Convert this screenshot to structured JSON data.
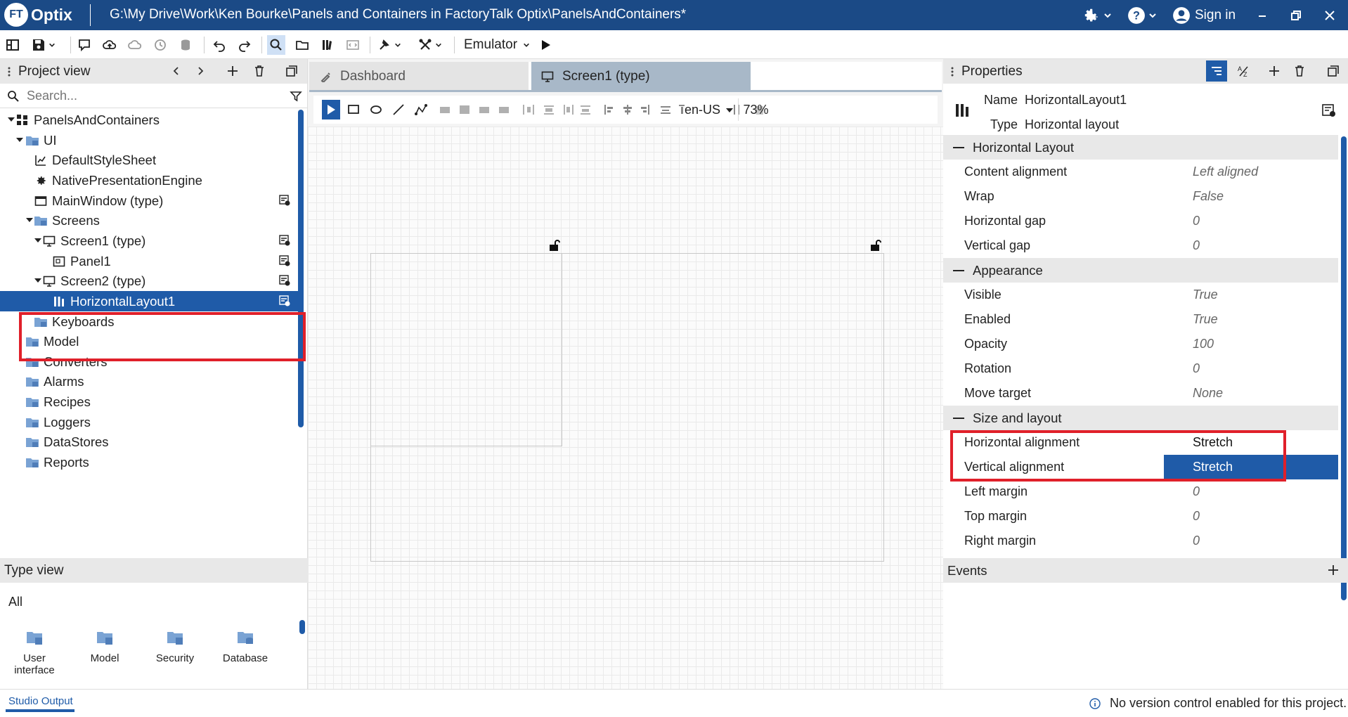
{
  "title_bar": {
    "logo_badge": "FT",
    "logo_text": "Optix",
    "path": "G:\\My Drive\\Work\\Ken Bourke\\Panels and Containers in FactoryTalk Optix\\PanelsAndContainers*",
    "sign_in": "Sign in",
    "accent_color": "#1b4a86"
  },
  "toolbar": {
    "emulator_label": "Emulator"
  },
  "project_view": {
    "title": "Project view",
    "search_placeholder": "Search...",
    "items": [
      {
        "label": "PanelsAndContainers",
        "icon": "project-icon",
        "expanded": true
      },
      {
        "label": "UI",
        "icon": "folder-icon",
        "expanded": true
      },
      {
        "label": "DefaultStyleSheet",
        "icon": "stylesheet-icon"
      },
      {
        "label": "NativePresentationEngine",
        "icon": "gear-icon"
      },
      {
        "label": "MainWindow (type)",
        "icon": "window-icon"
      },
      {
        "label": "Screens",
        "icon": "folder-icon",
        "expanded": true
      },
      {
        "label": "Screen1 (type)",
        "icon": "monitor-icon",
        "expanded": true
      },
      {
        "label": "Panel1",
        "icon": "panel-icon"
      },
      {
        "label": "Screen2 (type)",
        "icon": "monitor-icon",
        "expanded": true
      },
      {
        "label": "HorizontalLayout1",
        "icon": "horizontal-layout-icon",
        "selected": true
      },
      {
        "label": "Keyboards",
        "icon": "folder-icon"
      },
      {
        "label": "Model",
        "icon": "folder-icon"
      },
      {
        "label": "Converters",
        "icon": "folder-icon"
      },
      {
        "label": "Alarms",
        "icon": "folder-icon"
      },
      {
        "label": "Recipes",
        "icon": "folder-icon"
      },
      {
        "label": "Loggers",
        "icon": "folder-icon"
      },
      {
        "label": "DataStores",
        "icon": "folder-icon"
      },
      {
        "label": "Reports",
        "icon": "folder-icon"
      }
    ]
  },
  "type_view": {
    "title": "Type view",
    "filter": "All",
    "items": [
      {
        "label_line1": "User",
        "label_line2": "interface"
      },
      {
        "label_line1": "Model",
        "label_line2": ""
      },
      {
        "label_line1": "Security",
        "label_line2": ""
      },
      {
        "label_line1": "Database",
        "label_line2": ""
      }
    ]
  },
  "editor": {
    "tabs": [
      {
        "label": "Dashboard",
        "active": false
      },
      {
        "label": "Screen1 (type)",
        "active": true
      }
    ],
    "locale": "en-US",
    "zoom": "73%"
  },
  "properties": {
    "title": "Properties",
    "name_label": "Name",
    "name_value": "HorizontalLayout1",
    "type_label": "Type",
    "type_value": "Horizontal layout",
    "sections": [
      {
        "title": "Horizontal Layout",
        "rows": [
          {
            "label": "Content alignment",
            "value": "Left aligned"
          },
          {
            "label": "Wrap",
            "value": "False"
          },
          {
            "label": "Horizontal gap",
            "value": "0"
          },
          {
            "label": "Vertical gap",
            "value": "0"
          }
        ]
      },
      {
        "title": "Appearance",
        "rows": [
          {
            "label": "Visible",
            "value": "True"
          },
          {
            "label": "Enabled",
            "value": "True"
          },
          {
            "label": "Opacity",
            "value": "100"
          },
          {
            "label": "Rotation",
            "value": "0"
          },
          {
            "label": "Move target",
            "value": "None"
          }
        ]
      },
      {
        "title": "Size and layout",
        "rows": [
          {
            "label": "Horizontal alignment",
            "value": "Stretch"
          },
          {
            "label": "Vertical alignment",
            "value": "Stretch"
          },
          {
            "label": "Left margin",
            "value": "0"
          },
          {
            "label": "Top margin",
            "value": "0"
          },
          {
            "label": "Right margin",
            "value": "0"
          }
        ]
      }
    ],
    "events_title": "Events"
  },
  "status_bar": {
    "output_tab": "Studio Output",
    "message": "No version control enabled for this project."
  }
}
